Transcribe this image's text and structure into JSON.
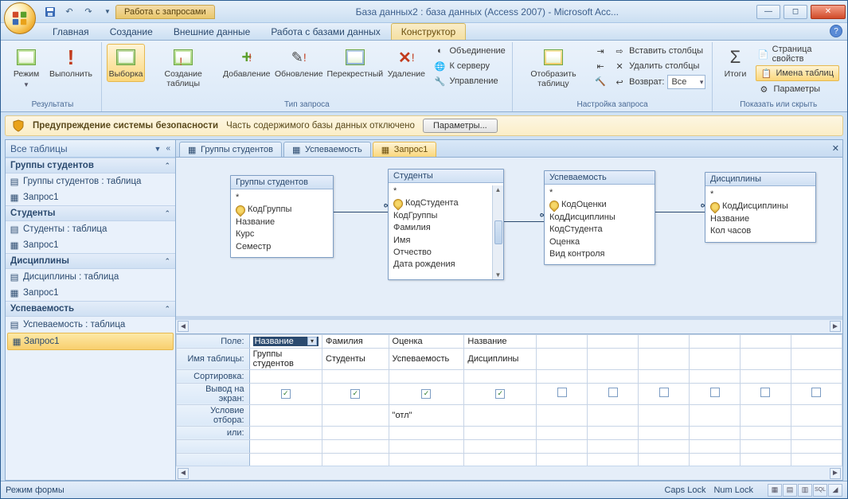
{
  "window": {
    "contextual_tab_group": "Работа с запросами",
    "title": "База данных2 : база данных (Access 2007) - Microsoft Acc..."
  },
  "tabs": {
    "home": "Главная",
    "create": "Создание",
    "external": "Внешние данные",
    "dbtools": "Работа с базами данных",
    "design": "Конструктор"
  },
  "ribbon": {
    "results": {
      "mode": "Режим",
      "run": "Выполнить",
      "label": "Результаты"
    },
    "querytype": {
      "select": "Выборка",
      "maketable": "Создание таблицы",
      "append": "Добавление",
      "update": "Обновление",
      "crosstab": "Перекрестный",
      "delete": "Удаление",
      "union": "Объединение",
      "passthrough": "К серверу",
      "datadef": "Управление",
      "label": "Тип запроса"
    },
    "setup": {
      "showtable": "Отобразить таблицу",
      "insertcols": "Вставить столбцы",
      "deletecols": "Удалить столбцы",
      "return_lbl": "Возврат:",
      "return_val": "Все",
      "label": "Настройка запроса"
    },
    "showhide": {
      "totals": "Итоги",
      "propsheet": "Страница свойств",
      "tablenames": "Имена таблиц",
      "params": "Параметры",
      "label": "Показать или скрыть"
    }
  },
  "security": {
    "heading": "Предупреждение системы безопасности",
    "msg": "Часть содержимого базы данных отключено",
    "button": "Параметры..."
  },
  "nav": {
    "header": "Все таблицы",
    "groups": [
      {
        "name": "Группы студентов",
        "items": [
          "Группы студентов : таблица",
          "Запрос1"
        ]
      },
      {
        "name": "Студенты",
        "items": [
          "Студенты : таблица",
          "Запрос1"
        ]
      },
      {
        "name": "Дисциплины",
        "items": [
          "Дисциплины : таблица",
          "Запрос1"
        ]
      },
      {
        "name": "Успеваемость",
        "items": [
          "Успеваемость : таблица",
          "Запрос1"
        ]
      }
    ]
  },
  "doctabs": {
    "t1": "Группы студентов",
    "t2": "Успеваемость",
    "t3": "Запрос1"
  },
  "diagram": {
    "tables": {
      "groups": {
        "title": "Группы студентов",
        "star": "*",
        "fields": [
          "КодГруппы",
          "Название",
          "Курс",
          "Семестр"
        ],
        "keyidx": 0
      },
      "students": {
        "title": "Студенты",
        "star": "*",
        "fields": [
          "КодСтудента",
          "КодГруппы",
          "Фамилия",
          "Имя",
          "Отчество",
          "Дата рождения"
        ],
        "keyidx": 0
      },
      "progress": {
        "title": "Успеваемость",
        "star": "*",
        "fields": [
          "КодОценки",
          "КодДисциплины",
          "КодСтудента",
          "Оценка",
          "Вид контроля"
        ],
        "keyidx": 0
      },
      "disc": {
        "title": "Дисциплины",
        "star": "*",
        "fields": [
          "КодДисциплины",
          "Название",
          "Кол часов"
        ],
        "keyidx": 0
      }
    }
  },
  "grid": {
    "rowlabels": {
      "field": "Поле:",
      "table": "Имя таблицы:",
      "sort": "Сортировка:",
      "show": "Вывод на экран:",
      "criteria": "Условие отбора:",
      "or": "или:"
    },
    "cols": [
      {
        "field": "Название",
        "table": "Группы студентов",
        "show": true,
        "criteria": ""
      },
      {
        "field": "Фамилия",
        "table": "Студенты",
        "show": true,
        "criteria": ""
      },
      {
        "field": "Оценка",
        "table": "Успеваемость",
        "show": true,
        "criteria": "\"отл\""
      },
      {
        "field": "Название",
        "table": "Дисциплины",
        "show": true,
        "criteria": ""
      }
    ]
  },
  "status": {
    "left": "Режим формы",
    "caps": "Caps Lock",
    "num": "Num Lock"
  }
}
